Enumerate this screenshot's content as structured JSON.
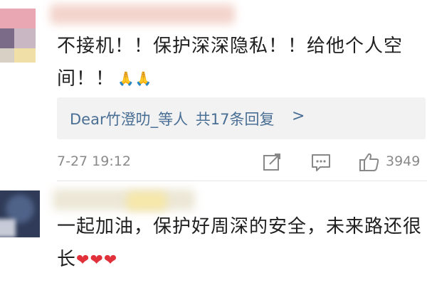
{
  "comments": [
    {
      "text": "不接机！！保护深深隐私！！给他个人空间！！",
      "emoji": "🙏🙏",
      "reply_summary": {
        "users": "Dear竹澄叻_等人",
        "count_text": "共17条回复",
        "chevron": ">"
      },
      "timestamp": "7-27 19:12",
      "actions": {
        "share_icon": "edit-share-icon",
        "comment_icon": "comment-bubble-icon",
        "like_icon": "thumbs-up-icon",
        "like_count": "3949"
      }
    },
    {
      "text": "一起加油，保护好周深的安全，未来路还很长",
      "emoji": "❤❤❤"
    }
  ],
  "colors": {
    "link": "#4a6f95",
    "meta": "#8a8a8a",
    "reply_bg": "#f2f2f2",
    "heart": "#e0313a"
  }
}
